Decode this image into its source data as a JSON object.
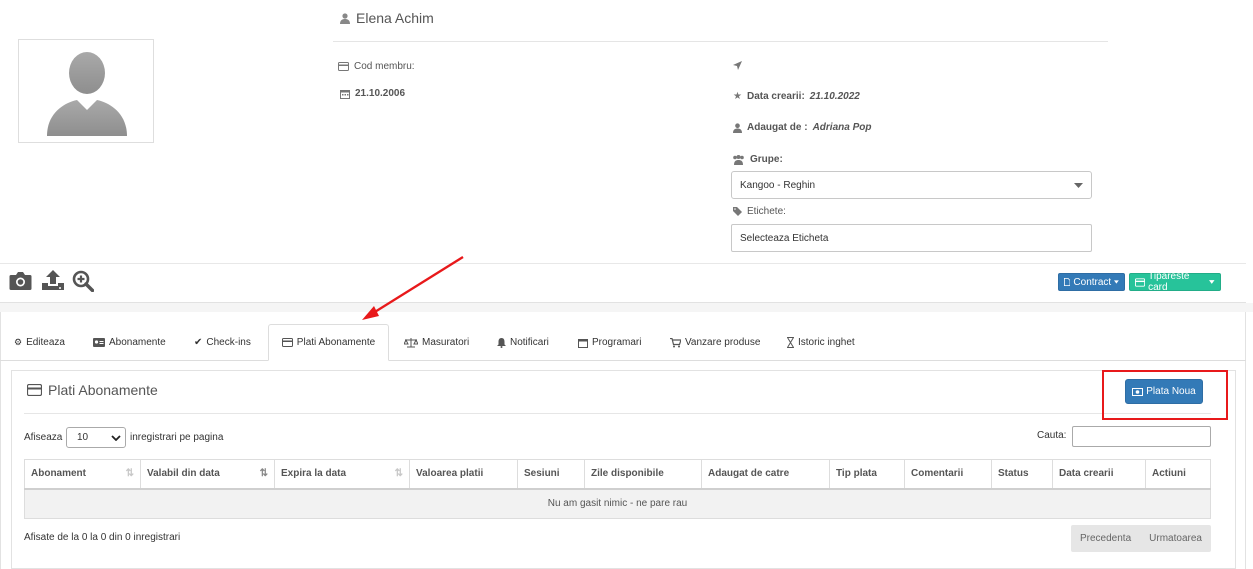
{
  "profile": {
    "name": "Elena Achim",
    "member_code_label": "Cod membru:",
    "birth_date": "21.10.2006",
    "created_label": "Data crearii:",
    "created_value": "21.10.2022",
    "added_by_label": "Adaugat de :",
    "added_by_value": "Adriana Pop",
    "groups_label": "Grupe:",
    "groups_value": "Kangoo - Reghin",
    "tags_label": "Etichete:",
    "tags_placeholder": "Selecteaza Eticheta"
  },
  "toolbar": {
    "contract_label": "Contract",
    "print_card_label": "Tipareste card"
  },
  "tabs": [
    {
      "label": "Editeaza",
      "icon": "gear-icon"
    },
    {
      "label": "Abonamente",
      "icon": "id-card-icon"
    },
    {
      "label": "Check-ins",
      "icon": "check-icon"
    },
    {
      "label": "Plati Abonamente",
      "icon": "credit-card-icon"
    },
    {
      "label": "Masuratori",
      "icon": "scale-icon"
    },
    {
      "label": "Notificari",
      "icon": "bell-icon"
    },
    {
      "label": "Programari",
      "icon": "calendar-icon"
    },
    {
      "label": "Vanzare produse",
      "icon": "cart-icon"
    },
    {
      "label": "Istoric inghet",
      "icon": "hourglass-icon"
    }
  ],
  "active_tab": "Plati Abonamente",
  "panel": {
    "title": "Plati Abonamente",
    "new_payment_label": "Plata Noua",
    "length_prefix": "Afiseaza",
    "length_value": "10",
    "length_suffix": "inregistrari pe pagina",
    "search_label": "Cauta:",
    "columns": [
      "Abonament",
      "Valabil din data",
      "Expira la data",
      "Valoarea platii",
      "Sesiuni",
      "Zile disponibile",
      "Adaugat de catre",
      "Tip plata",
      "Comentarii",
      "Status",
      "Data crearii",
      "Actiuni"
    ],
    "empty_message": "Nu am gasit nimic - ne pare rau",
    "info": "Afisate de la 0 la 0 din 0 inregistrari",
    "prev_label": "Precedenta",
    "next_label": "Urmatoarea"
  },
  "colors": {
    "primary": "#337ab7",
    "success": "#27c39a",
    "highlight": "#e8191b"
  }
}
